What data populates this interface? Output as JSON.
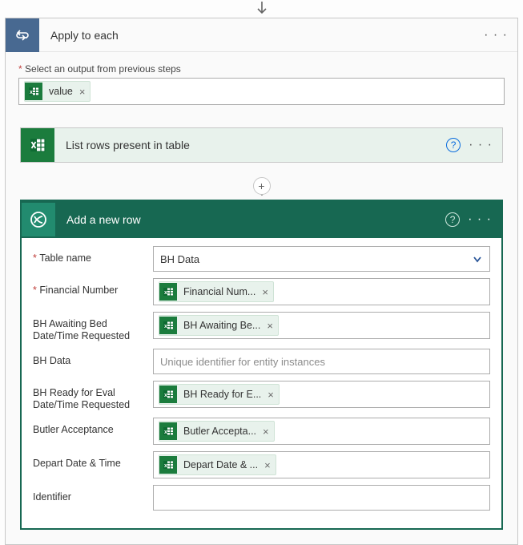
{
  "loop": {
    "title": "Apply to each",
    "select_label": "Select an output from previous steps",
    "value_token": "value"
  },
  "excel": {
    "title": "List rows present in table"
  },
  "dataverse": {
    "title": "Add a new row",
    "rows": {
      "table_name": {
        "label": "Table name",
        "value": "BH Data"
      },
      "financial_number": {
        "label": "Financial Number",
        "token": "Financial Num..."
      },
      "bh_awaiting": {
        "label": "BH Awaiting Bed Date/Time Requested",
        "token": "BH Awaiting Be..."
      },
      "bh_data": {
        "label": "BH Data",
        "placeholder": "Unique identifier for entity instances"
      },
      "bh_ready": {
        "label": "BH Ready for Eval Date/Time Requested",
        "token": "BH Ready for E..."
      },
      "butler": {
        "label": "Butler Acceptance",
        "token": "Butler Accepta..."
      },
      "depart": {
        "label": "Depart Date & Time",
        "token": "Depart Date & ..."
      },
      "identifier": {
        "label": "Identifier"
      }
    }
  }
}
